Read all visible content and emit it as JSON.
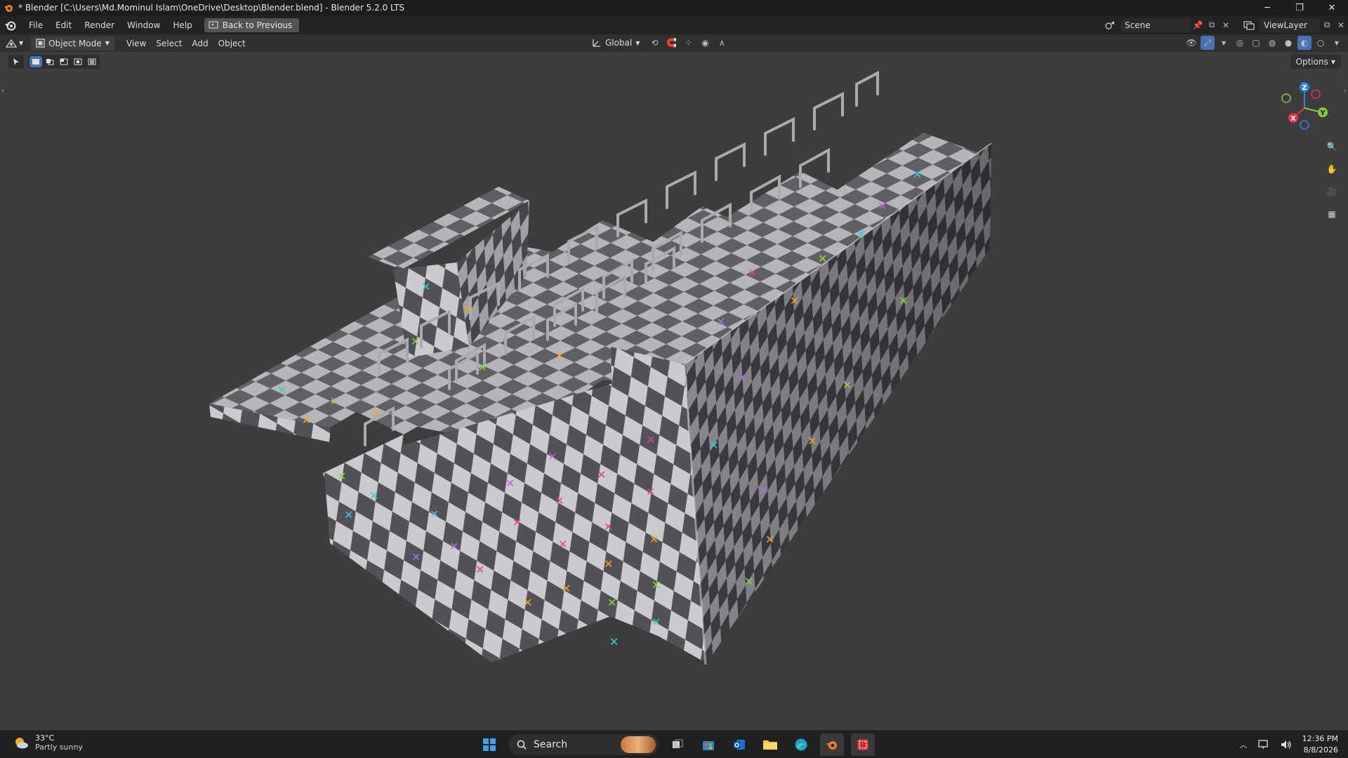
{
  "window": {
    "title": "* Blender [C:\\Users\\Md.Mominul Islam\\OneDrive\\Desktop\\Blender.blend] - Blender 5.2.0 LTS",
    "controls": [
      "─",
      "❐",
      "✕"
    ]
  },
  "menubar": {
    "items": [
      "File",
      "Edit",
      "Render",
      "Window",
      "Help"
    ],
    "back_button": "Back to Previous",
    "scene": "Scene",
    "view_layer": "ViewLayer"
  },
  "viewport_header": {
    "mode": "Object Mode",
    "menus": [
      "View",
      "Select",
      "Add",
      "Object"
    ],
    "transform_orientation": "Global"
  },
  "viewport": {
    "options": "Options",
    "gizmo_axes": [
      "Z",
      "Y",
      "X"
    ]
  },
  "taskbar": {
    "weather_temp": "33°C",
    "weather_condition": "Partly sunny",
    "search_placeholder": "Search",
    "time": "12:36 PM",
    "date": "8/8/2026"
  },
  "colors": {
    "accent": "#4772b3",
    "axis_x": "#e8344a",
    "axis_y": "#8bc63f",
    "axis_z": "#2f84e3"
  }
}
